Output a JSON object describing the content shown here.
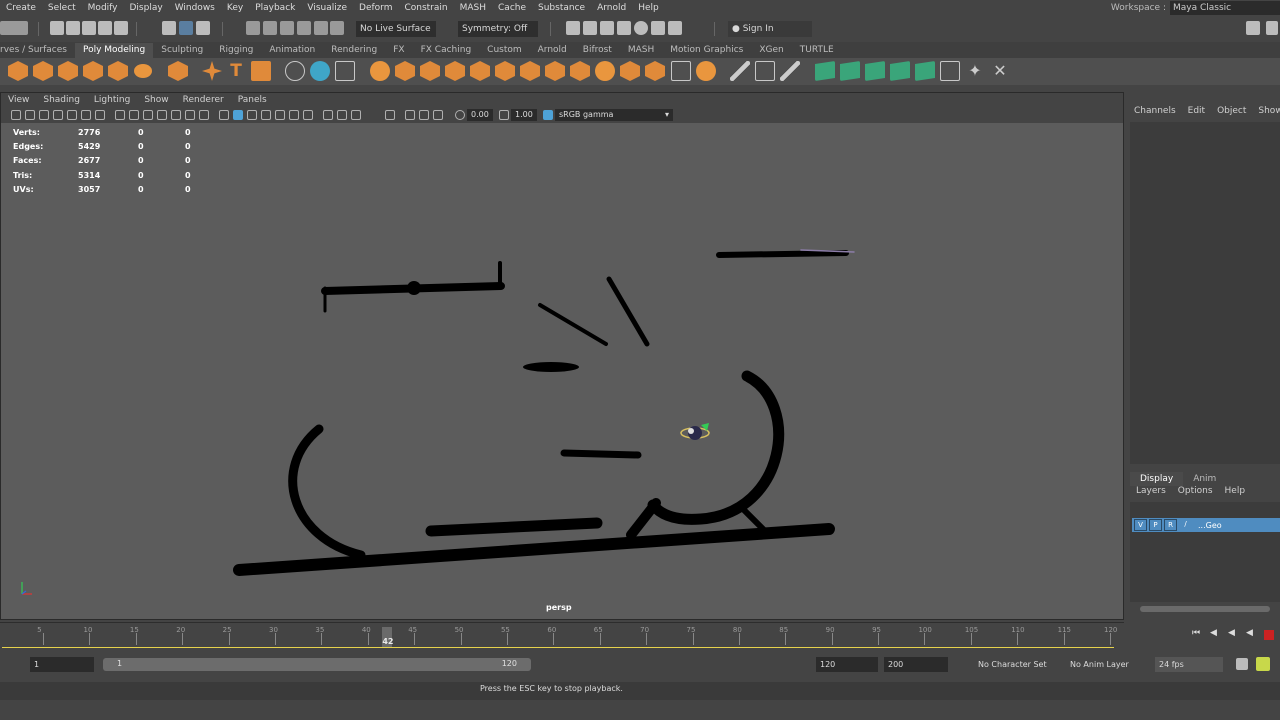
{
  "menubar": {
    "items": [
      "Create",
      "Select",
      "Modify",
      "Display",
      "Windows",
      "Key",
      "Playback",
      "Visualize",
      "Deform",
      "Constrain",
      "MASH",
      "Cache",
      "Substance",
      "Arnold",
      "Help"
    ],
    "workspace_label": "Workspace :",
    "workspace_value": "Maya Classic"
  },
  "statusline": {
    "live_surface": "No Live Surface",
    "symmetry": "Symmetry: Off",
    "sign_in": "Sign In"
  },
  "shelf": {
    "tabs": [
      "rves / Surfaces",
      "Poly Modeling",
      "Sculpting",
      "Rigging",
      "Animation",
      "Rendering",
      "FX",
      "FX Caching",
      "Custom",
      "Arnold",
      "Bifrost",
      "MASH",
      "Motion Graphics",
      "XGen",
      "TURTLE"
    ],
    "active_tab": 1
  },
  "viewport": {
    "menu": [
      "View",
      "Shading",
      "Lighting",
      "Show",
      "Renderer",
      "Panels"
    ],
    "exposure": "0.00",
    "gamma": "1.00",
    "color_space": "sRGB gamma",
    "camera": "persp",
    "hud": [
      {
        "label": "Verts:",
        "value": "2776",
        "a": "0",
        "b": "0"
      },
      {
        "label": "Edges:",
        "value": "5429",
        "a": "0",
        "b": "0"
      },
      {
        "label": "Faces:",
        "value": "2677",
        "a": "0",
        "b": "0"
      },
      {
        "label": "Tris:",
        "value": "5314",
        "a": "0",
        "b": "0"
      },
      {
        "label": "UVs:",
        "value": "3057",
        "a": "0",
        "b": "0"
      }
    ]
  },
  "channel_box": {
    "menu": [
      "Channels",
      "Edit",
      "Object",
      "Show"
    ]
  },
  "layer_editor": {
    "tabs": [
      "Display",
      "Anim"
    ],
    "menu": [
      "Layers",
      "Options",
      "Help"
    ],
    "layer": {
      "v": "V",
      "p": "P",
      "r": "R",
      "name": "...Geo"
    }
  },
  "timeslider": {
    "ticks": [
      "5",
      "10",
      "15",
      "20",
      "25",
      "30",
      "35",
      "40",
      "45",
      "50",
      "55",
      "60",
      "65",
      "70",
      "75",
      "80",
      "85",
      "90",
      "95",
      "100",
      "105",
      "110",
      "115",
      "120"
    ],
    "current_frame": "42"
  },
  "rangeslider": {
    "start": "1",
    "range_start": "1",
    "range_end": "120",
    "end": "120",
    "anim_end": "200",
    "character_set": "No Character Set",
    "anim_layer": "No Anim Layer",
    "fps": "24 fps"
  },
  "helpline": {
    "text": "Press the ESC key to stop playback."
  },
  "colors": {
    "viewport_bg": "#5c5c5c",
    "accent_blue": "#4f8cc0",
    "timeline_yellow": "#e6d24c",
    "shelf_orange": "#e08a3a",
    "shelf_green": "#3aa57a"
  }
}
